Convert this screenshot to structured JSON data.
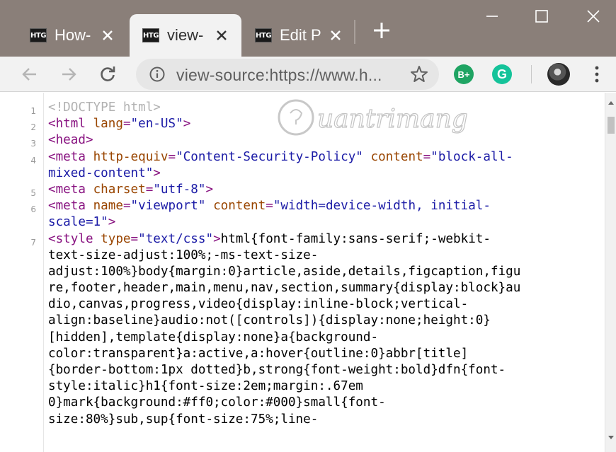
{
  "tabs": [
    {
      "label": "How-",
      "favicon_text": "HTG",
      "active": false
    },
    {
      "label": "view-",
      "favicon_text": "HTG",
      "active": true
    },
    {
      "label": "Edit P",
      "favicon_text": "HTG",
      "active": false
    }
  ],
  "window_controls": {
    "minimize": "minimize-icon",
    "maximize": "maximize-icon",
    "close": "close-icon"
  },
  "toolbar": {
    "url": "view-source:https://www.h...",
    "extensions": [
      {
        "name": "grammarly-bplus",
        "text": "B+",
        "color": "#1fa463"
      },
      {
        "name": "grammarly",
        "text": "G",
        "color": "#15c39a"
      }
    ]
  },
  "watermark": {
    "text": "uantrimang"
  },
  "source": {
    "line_numbers": [
      {
        "n": "1",
        "row": 0
      },
      {
        "n": "2",
        "row": 1
      },
      {
        "n": "3",
        "row": 2
      },
      {
        "n": "4",
        "row": 3
      },
      {
        "n": "5",
        "row": 5
      },
      {
        "n": "6",
        "row": 6
      },
      {
        "n": "7",
        "row": 8
      }
    ],
    "lines": [
      [
        {
          "c": "c",
          "t": "<!DOCTYPE html>"
        }
      ],
      [
        {
          "c": "t",
          "t": "<html "
        },
        {
          "c": "a",
          "t": "lang"
        },
        {
          "c": "t",
          "t": "="
        },
        {
          "c": "v",
          "t": "\"en-US\""
        },
        {
          "c": "t",
          "t": ">"
        }
      ],
      [
        {
          "c": "t",
          "t": "<head>"
        }
      ],
      [
        {
          "c": "t",
          "t": "<meta "
        },
        {
          "c": "a",
          "t": "http-equiv"
        },
        {
          "c": "t",
          "t": "="
        },
        {
          "c": "v",
          "t": "\"Content-Security-Policy\""
        },
        {
          "c": "x",
          "t": " "
        },
        {
          "c": "a",
          "t": "content"
        },
        {
          "c": "t",
          "t": "="
        },
        {
          "c": "v",
          "t": "\"block-all-"
        }
      ],
      [
        {
          "c": "v",
          "t": "mixed-content\""
        },
        {
          "c": "t",
          "t": ">"
        }
      ],
      [
        {
          "c": "t",
          "t": "<meta "
        },
        {
          "c": "a",
          "t": "charset"
        },
        {
          "c": "t",
          "t": "="
        },
        {
          "c": "v",
          "t": "\"utf-8\""
        },
        {
          "c": "t",
          "t": ">"
        }
      ],
      [
        {
          "c": "t",
          "t": "<meta "
        },
        {
          "c": "a",
          "t": "name"
        },
        {
          "c": "t",
          "t": "="
        },
        {
          "c": "v",
          "t": "\"viewport\""
        },
        {
          "c": "x",
          "t": " "
        },
        {
          "c": "a",
          "t": "content"
        },
        {
          "c": "t",
          "t": "="
        },
        {
          "c": "v",
          "t": "\"width=device-width, initial-"
        }
      ],
      [
        {
          "c": "v",
          "t": "scale=1\""
        },
        {
          "c": "t",
          "t": ">"
        }
      ],
      [
        {
          "c": "t",
          "t": "<style "
        },
        {
          "c": "a",
          "t": "type"
        },
        {
          "c": "t",
          "t": "="
        },
        {
          "c": "v",
          "t": "\"text/css\""
        },
        {
          "c": "t",
          "t": ">"
        },
        {
          "c": "x",
          "t": "html{font-family:sans-serif;-webkit-"
        }
      ],
      [
        {
          "c": "x",
          "t": "text-size-adjust:100%;-ms-text-size-"
        }
      ],
      [
        {
          "c": "x",
          "t": "adjust:100%}body{margin:0}article,aside,details,figcaption,figu"
        }
      ],
      [
        {
          "c": "x",
          "t": "re,footer,header,main,menu,nav,section,summary{display:block}au"
        }
      ],
      [
        {
          "c": "x",
          "t": "dio,canvas,progress,video{display:inline-block;vertical-"
        }
      ],
      [
        {
          "c": "x",
          "t": "align:baseline}audio:not([controls]){display:none;height:0}"
        }
      ],
      [
        {
          "c": "x",
          "t": "[hidden],template{display:none}a{background-"
        }
      ],
      [
        {
          "c": "x",
          "t": "color:transparent}a:active,a:hover{outline:0}abbr[title]"
        }
      ],
      [
        {
          "c": "x",
          "t": "{border-bottom:1px dotted}b,strong{font-weight:bold}dfn{font-"
        }
      ],
      [
        {
          "c": "x",
          "t": "style:italic}h1{font-size:2em;margin:.67em"
        }
      ],
      [
        {
          "c": "x",
          "t": "0}mark{background:#ff0;color:#000}small{font-"
        }
      ],
      [
        {
          "c": "x",
          "t": "size:80%}sub,sup{font-size:75%;line-"
        }
      ]
    ]
  }
}
